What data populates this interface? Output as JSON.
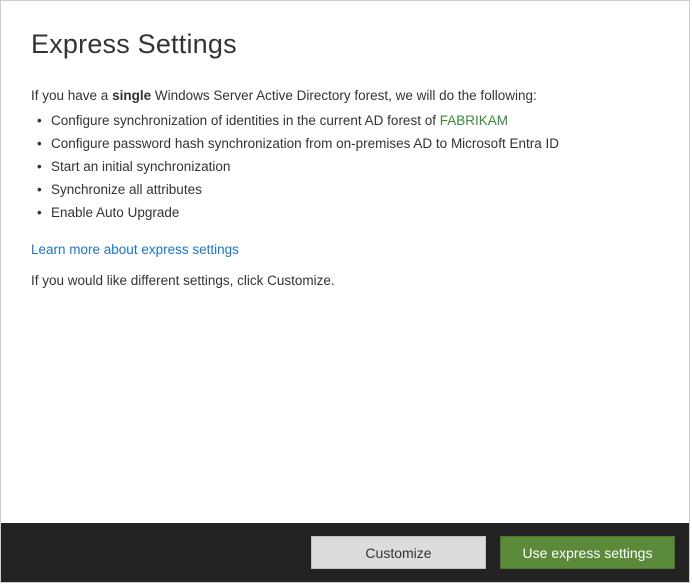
{
  "page": {
    "title": "Express Settings",
    "intro_prefix": "If you have a ",
    "intro_bold": "single",
    "intro_suffix": " Windows Server Active Directory forest, we will do the following:",
    "bullets": [
      {
        "prefix": "Configure synchronization of identities in the current AD forest of ",
        "forest": "FABRIKAM",
        "suffix": ""
      },
      {
        "prefix": "Configure password hash synchronization from on-premises AD to Microsoft Entra ID",
        "forest": "",
        "suffix": ""
      },
      {
        "prefix": "Start an initial synchronization",
        "forest": "",
        "suffix": ""
      },
      {
        "prefix": "Synchronize all attributes",
        "forest": "",
        "suffix": ""
      },
      {
        "prefix": "Enable Auto Upgrade",
        "forest": "",
        "suffix": ""
      }
    ],
    "learn_more": "Learn more about express settings",
    "customize_note": "If you would like different settings, click Customize."
  },
  "footer": {
    "customize_label": "Customize",
    "express_label": "Use express settings"
  }
}
